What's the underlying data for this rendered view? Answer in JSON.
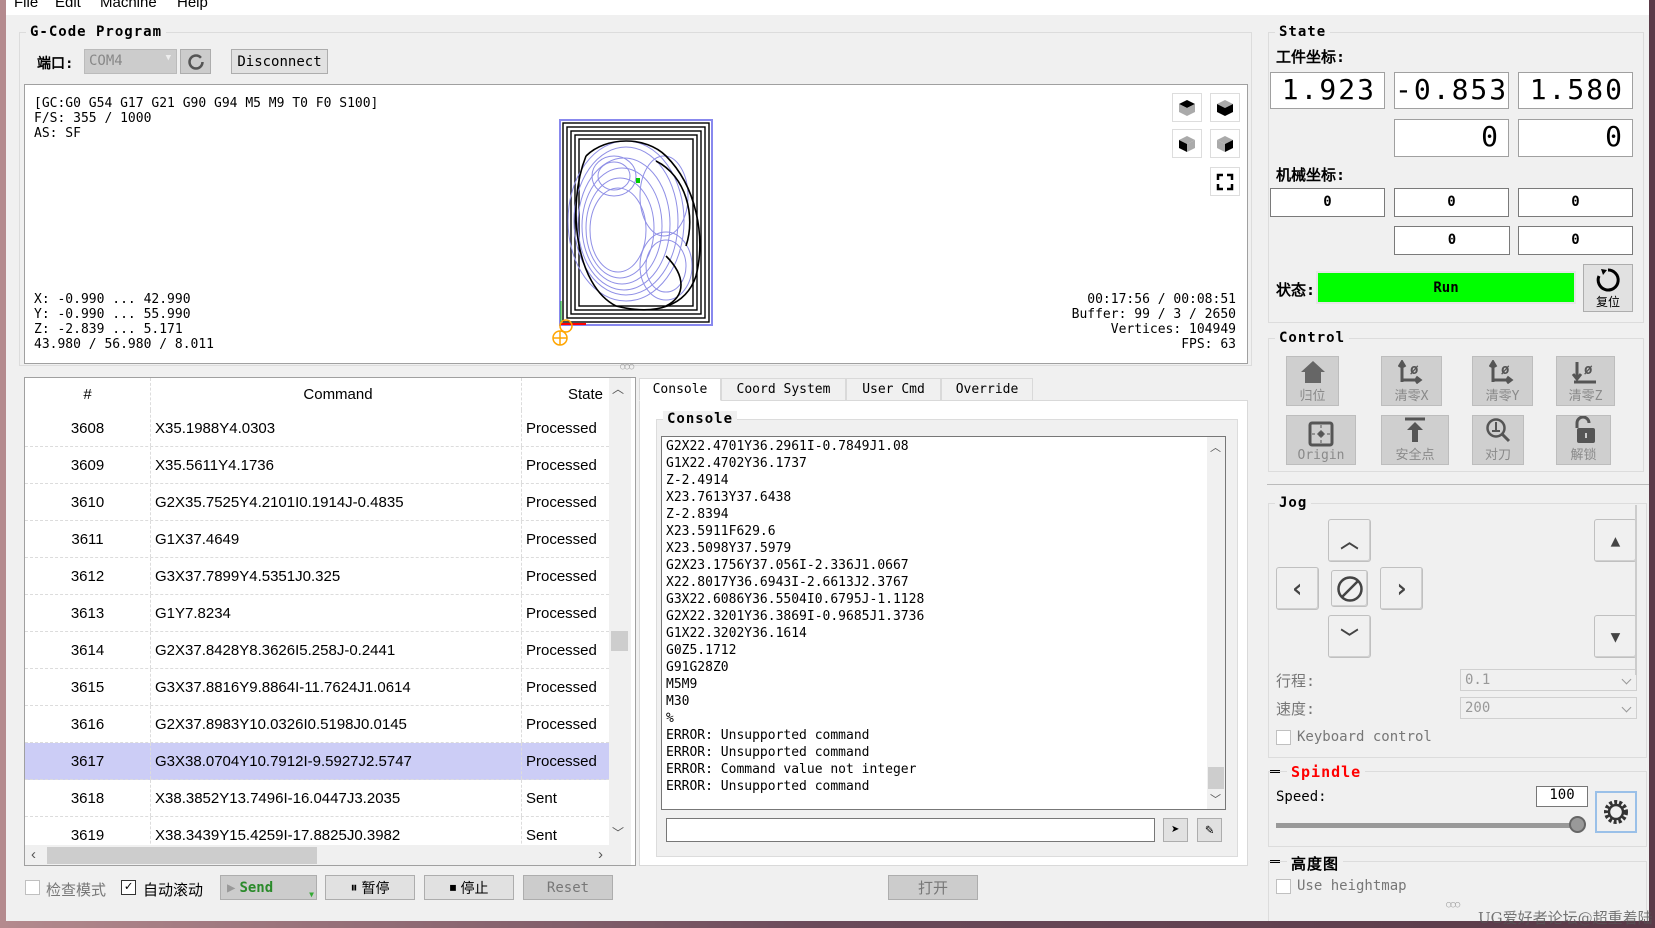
{
  "menu": [
    "File",
    "Edit",
    "Machine",
    "Help"
  ],
  "gcode": {
    "title": "G-Code Program",
    "port_label": "端口:",
    "port_value": "COM4",
    "disconnect": "Disconnect"
  },
  "viewer": {
    "top_lines": [
      "[GC:G0 G54 G17 G21 G90 G94 M5 M9 T0 F0 S100]",
      "F/S: 355 / 1000",
      "AS: SF"
    ],
    "bottom_left": [
      "X: -0.990 ... 42.990",
      "Y: -0.990 ... 55.990",
      "Z: -2.839 ... 5.171",
      "43.980 / 56.980 / 8.011"
    ],
    "bottom_right": [
      "00:17:56 / 00:08:51",
      "Buffer: 99 / 3 / 2650",
      "Vertices: 104949",
      "FPS: 63"
    ]
  },
  "table": {
    "headers": [
      "#",
      "Command",
      "State"
    ],
    "selected_row": "3617",
    "rows": [
      [
        "3608",
        "X35.1988Y4.0303",
        "Processed"
      ],
      [
        "3609",
        "X35.5611Y4.1736",
        "Processed"
      ],
      [
        "3610",
        "G2X35.7525Y4.2101I0.1914J-0.4835",
        "Processed"
      ],
      [
        "3611",
        "G1X37.4649",
        "Processed"
      ],
      [
        "3612",
        "G3X37.7899Y4.5351J0.325",
        "Processed"
      ],
      [
        "3613",
        "G1Y7.8234",
        "Processed"
      ],
      [
        "3614",
        "G2X37.8428Y8.3626I5.258J-0.2441",
        "Processed"
      ],
      [
        "3615",
        "G3X37.8816Y9.8864I-11.7624J1.0614",
        "Processed"
      ],
      [
        "3616",
        "G2X37.8983Y10.0326I0.5198J0.0145",
        "Processed"
      ],
      [
        "3617",
        "G3X38.0704Y10.7912I-9.5927J2.5747",
        "Processed"
      ],
      [
        "3618",
        "X38.3852Y13.7496I-16.0447J3.2035",
        "Sent"
      ],
      [
        "3619",
        "X38.3439Y15.4259I-17.8825J0.3982",
        "Sent"
      ]
    ]
  },
  "bottom": {
    "check_mode": "检查模式",
    "auto_scroll": "自动滚动",
    "auto_scroll_checked": true,
    "send": "Send",
    "pause": "暂停",
    "stop": "停止",
    "reset": "Reset",
    "open": "打开"
  },
  "tabs": [
    "Console",
    "Coord System",
    "User Cmd",
    "Override"
  ],
  "console": {
    "title": "Console",
    "lines": [
      "G2X22.4701Y36.2961I-0.7849J1.08",
      "G1X22.4702Y36.1737",
      "Z-2.4914",
      "X23.7613Y37.6438",
      "Z-2.8394",
      "X23.5911F629.6",
      "X23.5098Y37.5979",
      "G2X23.1756Y37.056I-2.336J1.0667",
      "X22.8017Y36.6943I-2.6613J2.3767",
      "G3X22.6086Y36.5504I0.6795J-1.1128",
      "G2X22.3201Y36.3869I-0.9685J1.3736",
      "G1X22.3202Y36.1614",
      "G0Z5.1712",
      "G91G28Z0",
      "M5M9",
      "M30",
      "%",
      "ERROR: Unsupported command",
      "ERROR: Unsupported command",
      "ERROR: Command value not integer",
      "ERROR: Unsupported command"
    ],
    "input": ""
  },
  "state": {
    "title": "State",
    "work_label": "工件坐标:",
    "work": [
      "1.923",
      "-0.853",
      "1.580",
      "0",
      "0"
    ],
    "machine_label": "机械坐标:",
    "machine": [
      "0",
      "0",
      "0",
      "0",
      "0"
    ],
    "status_label": "状态:",
    "status": "Run",
    "status_color": "#00ff00",
    "reset": "复位"
  },
  "control": {
    "title": "Control",
    "buttons": [
      "归位",
      "清零X",
      "清零Y",
      "清零Z",
      "Origin",
      "安全点",
      "对刀",
      "解锁"
    ]
  },
  "jog": {
    "title": "Jog",
    "step_label": "行程:",
    "step_value": "0.1",
    "feed_label": "速度:",
    "feed_value": "200",
    "keyboard": "Keyboard control"
  },
  "spindle": {
    "title": "Spindle",
    "title_color": "#ff0000",
    "speed_label": "Speed:",
    "speed": "100",
    "slider_fraction": 1.0
  },
  "heightmap": {
    "title": "高度图",
    "use": "Use heightmap"
  },
  "watermark": "UG爱好者论坛@超重着陆"
}
